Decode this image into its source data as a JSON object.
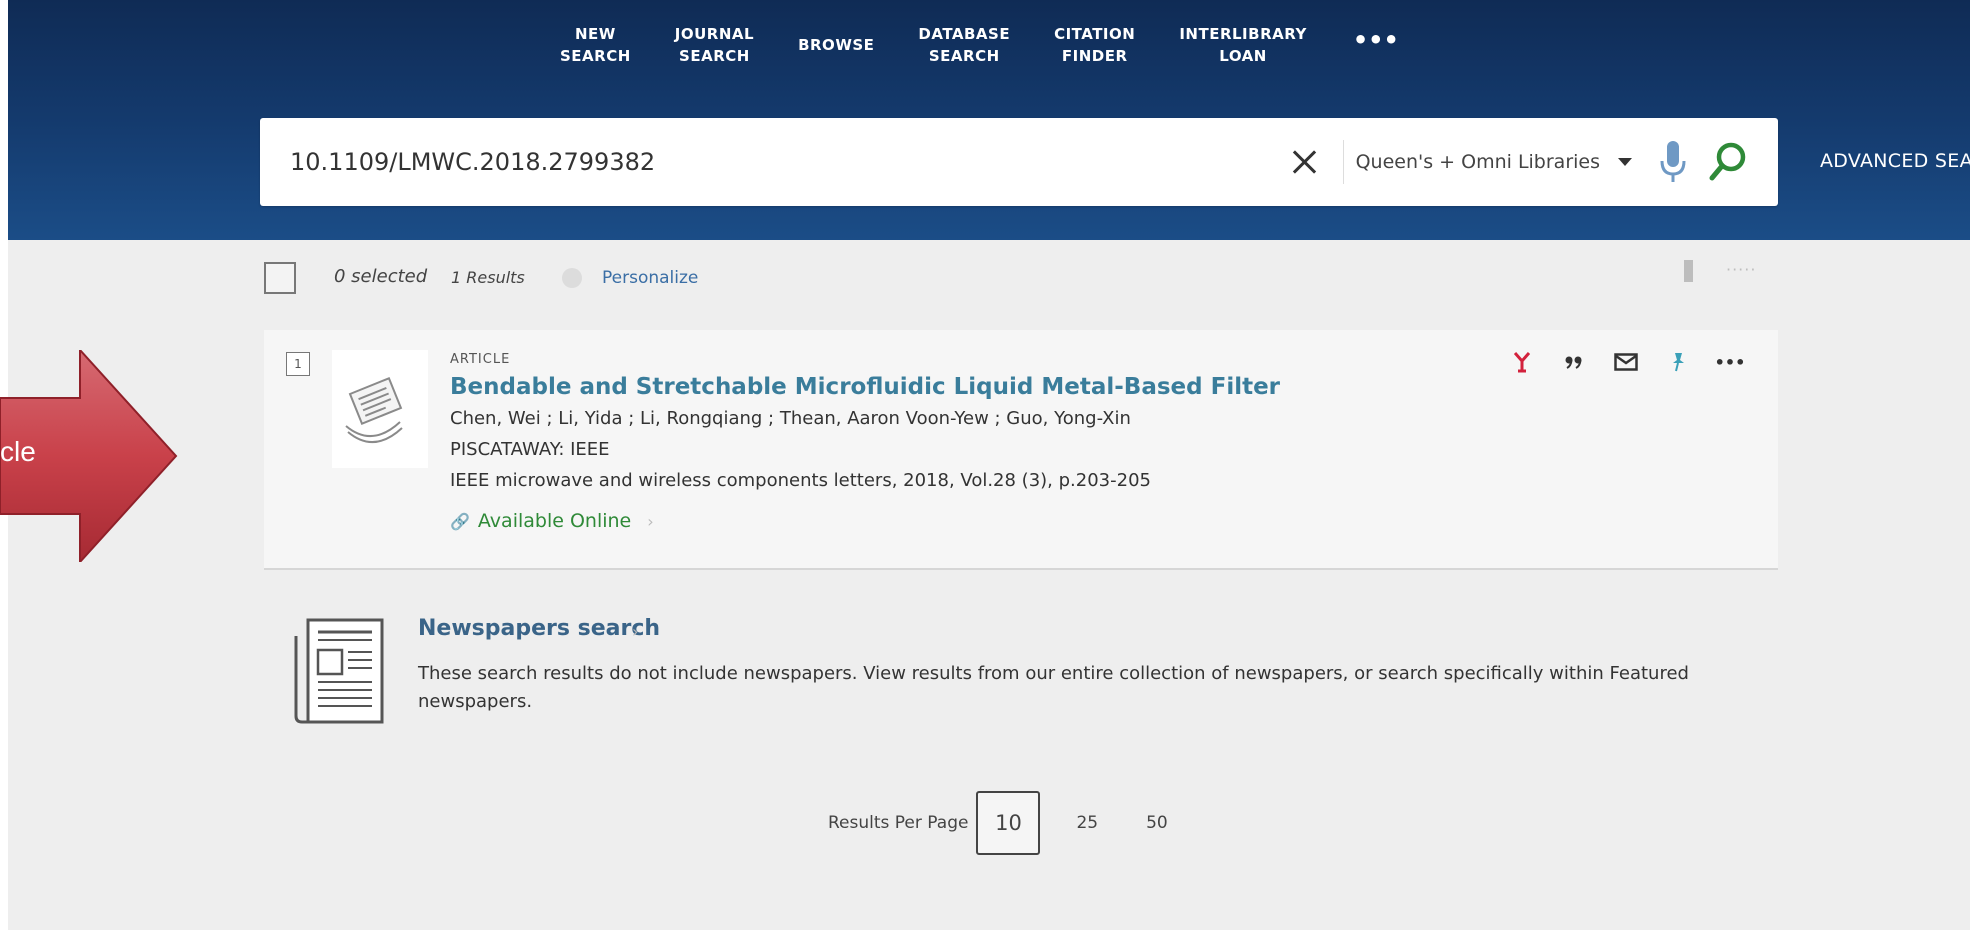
{
  "nav": {
    "items": [
      {
        "label": "NEW\nSEARCH"
      },
      {
        "label": "JOURNAL\nSEARCH"
      },
      {
        "label": "BROWSE"
      },
      {
        "label": "DATABASE\nSEARCH"
      },
      {
        "label": "CITATION\nFINDER"
      },
      {
        "label": "INTERLIBRARY\nLOAN"
      }
    ],
    "more_label": "•••"
  },
  "search": {
    "query": "10.1109/LMWC.2018.2799382",
    "scope": "Queen's + Omni Libraries",
    "advanced_label": "ADVANCED SEARC"
  },
  "results_bar": {
    "selected_label": "0 selected",
    "results_label": "1 Results",
    "personalize_label": "Personalize",
    "more_label": "·····"
  },
  "result": {
    "index": "1",
    "type": "ARTICLE",
    "title": "Bendable and Stretchable Microfluidic Liquid Metal-Based Filter",
    "authors": "Chen, Wei ; Li, Yida ; Li, Rongqiang ; Thean, Aaron Voon-Yew ; Guo, Yong-Xin",
    "publisher": "PISCATAWAY: IEEE",
    "source": "IEEE microwave and wireless components letters, 2018, Vol.28 (3), p.203-205",
    "availability": "Available Online",
    "availability_chevron": "›",
    "link_icon": "🔗"
  },
  "actions": {
    "icons": [
      "citation-trail-icon",
      "quote-icon",
      "email-icon",
      "pin-icon",
      "more-icon"
    ],
    "more_label": "•••"
  },
  "newspapers": {
    "title": "Newspapers search",
    "chevron": "›",
    "description": "These search results do not include newspapers. View results from our entire collection of newspapers, or search specifically within Featured newspapers."
  },
  "pagination": {
    "label": "Results Per Page",
    "options": [
      "10",
      "25",
      "50"
    ],
    "selected": "10"
  },
  "overlay": {
    "arrow_text": "cle",
    "arrow_fill": "#c9414a"
  },
  "colors": {
    "header_top": "#0f2b55",
    "header_bottom": "#1b4d87",
    "title_link": "#3a7d9b",
    "available_green": "#2f8a38"
  }
}
